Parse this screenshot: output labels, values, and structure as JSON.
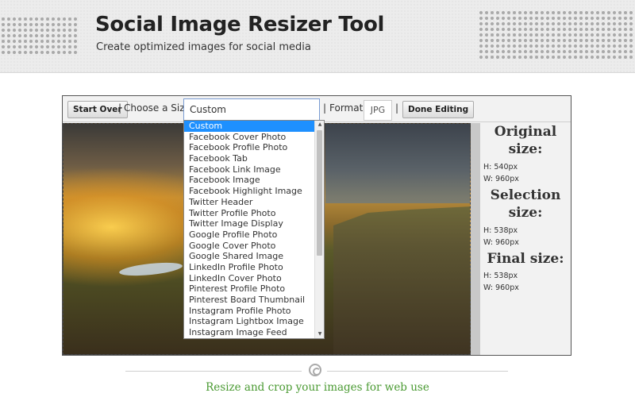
{
  "header": {
    "title": "Social Image Resizer Tool",
    "subtitle": "Create optimized images for social media"
  },
  "toolbar": {
    "start_over_label": "Start Over",
    "separator": "|",
    "choose_size_label": "Choose a Size:",
    "size_selected": "Custom",
    "format_label": "Format:",
    "format_value": "JPG",
    "done_label": "Done Editing"
  },
  "dropdown": {
    "options": [
      "Custom",
      "Facebook Cover Photo",
      "Facebook Profile Photo",
      "Facebook Tab",
      "Facebook Link Image",
      "Facebook Image",
      "Facebook Highlight Image",
      "Twitter Header",
      "Twitter Profile Photo",
      "Twitter Image Display",
      "Google Profile Photo",
      "Google Cover Photo",
      "Google Shared Image",
      "LinkedIn Profile Photo",
      "LinkedIn Cover Photo",
      "Pinterest Profile Photo",
      "Pinterest Board Thumbnail",
      "Instagram Profile Photo",
      "Instagram Lightbox Image",
      "Instagram Image Feed"
    ]
  },
  "info": {
    "original_title_1": "Original",
    "original_title_2": "size:",
    "original_h": "H: 540px",
    "original_w": "W: 960px",
    "selection_title_1": "Selection",
    "selection_title_2": "size:",
    "selection_h": "H: 538px",
    "selection_w": "W: 960px",
    "final_title": "Final size:",
    "final_h": "H: 538px",
    "final_w": "W: 960px"
  },
  "footer": {
    "tagline": "Resize and crop your images for web use"
  },
  "colors": {
    "accent_green": "#4a9a32",
    "selected_blue": "#1e90ff"
  }
}
